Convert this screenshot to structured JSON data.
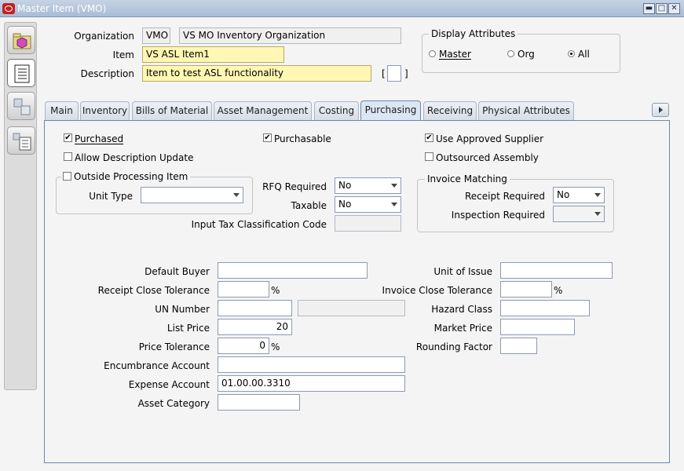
{
  "window": {
    "title": "Master Item (VMO)",
    "minimize": "▬",
    "restore": "□",
    "close": "✕"
  },
  "header": {
    "organization_label": "Organization",
    "organization_code": "VMO",
    "organization_name": "VS MO Inventory Organization",
    "item_label": "Item",
    "item_value": "VS ASL Item1",
    "description_label": "Description",
    "description_value": "Item to test ASL functionality",
    "bracket_open": "[",
    "bracket_close": "]"
  },
  "display_attributes": {
    "title": "Display Attributes",
    "options": [
      "Master",
      "Org",
      "All"
    ],
    "selected": "All"
  },
  "tabs": [
    {
      "label": "Main"
    },
    {
      "label": "Inventory"
    },
    {
      "label": "Bills of Material"
    },
    {
      "label": "Asset Management"
    },
    {
      "label": "Costing"
    },
    {
      "label": "Purchasing",
      "active": true
    },
    {
      "label": "Receiving"
    },
    {
      "label": "Physical Attributes"
    }
  ],
  "purchasing": {
    "purchased": {
      "label": "Purchased",
      "checked": true
    },
    "purchasable": {
      "label": "Purchasable",
      "checked": true
    },
    "use_approved_supplier": {
      "label": "Use Approved Supplier",
      "checked": true
    },
    "allow_description_update": {
      "label": "Allow Description Update",
      "checked": false
    },
    "outsourced_assembly": {
      "label": "Outsourced Assembly",
      "checked": false
    },
    "outside_processing_item": {
      "label": "Outside Processing Item",
      "checked": false
    },
    "unit_type_label": "Unit Type",
    "unit_type_value": "",
    "rfq_required_label": "RFQ Required",
    "rfq_required_value": "No",
    "taxable_label": "Taxable",
    "taxable_value": "No",
    "input_tax_label": "Input Tax Classification Code",
    "input_tax_value": "",
    "invoice_matching": {
      "title": "Invoice Matching",
      "receipt_required_label": "Receipt Required",
      "receipt_required_value": "No",
      "inspection_required_label": "Inspection Required",
      "inspection_required_value": ""
    },
    "default_buyer_label": "Default Buyer",
    "default_buyer_value": "",
    "receipt_close_tolerance_label": "Receipt Close Tolerance",
    "receipt_close_tolerance_value": "",
    "percent": "%",
    "un_number_label": "UN Number",
    "un_number_value": "",
    "un_number_desc": "",
    "list_price_label": "List Price",
    "list_price_value": "20",
    "price_tolerance_label": "Price Tolerance",
    "price_tolerance_value": "0",
    "encumbrance_account_label": "Encumbrance Account",
    "encumbrance_account_value": "",
    "expense_account_label": "Expense Account",
    "expense_account_value": "01.00.00.3310",
    "asset_category_label": "Asset Category",
    "asset_category_value": "",
    "unit_of_issue_label": "Unit of Issue",
    "unit_of_issue_value": "",
    "invoice_close_tolerance_label": "Invoice Close Tolerance",
    "invoice_close_tolerance_value": "",
    "hazard_class_label": "Hazard Class",
    "hazard_class_value": "",
    "market_price_label": "Market Price",
    "market_price_value": "",
    "rounding_factor_label": "Rounding Factor",
    "rounding_factor_value": ""
  }
}
